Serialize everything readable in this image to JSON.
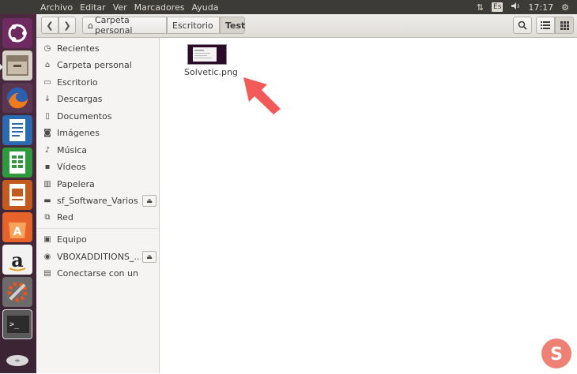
{
  "menubar": {
    "items": [
      "Archivo",
      "Editar",
      "Ver",
      "Marcadores",
      "Ayuda"
    ],
    "keyboard_layout": "Es",
    "clock": "17:17"
  },
  "launcher": {
    "apps": [
      "ubuntu-dash",
      "files",
      "firefox",
      "libreoffice-writer",
      "libreoffice-calc",
      "libreoffice-impress",
      "ubuntu-software",
      "amazon",
      "system-settings",
      "terminal",
      "dvd"
    ]
  },
  "toolbar": {
    "back_icon": "chevron-left-icon",
    "forward_icon": "chevron-right-icon",
    "breadcrumbs": [
      "Carpeta personal",
      "Escritorio",
      "Test"
    ],
    "home_glyph": "⌂",
    "search_icon": "search-icon",
    "list_view_icon": "list-icon",
    "grid_view_icon": "grid-icon"
  },
  "sidebar": {
    "items": [
      {
        "label": "Recientes",
        "icon": "clock-icon"
      },
      {
        "label": "Carpeta personal",
        "icon": "home-icon"
      },
      {
        "label": "Escritorio",
        "icon": "folder-icon"
      },
      {
        "label": "Descargas",
        "icon": "download-icon"
      },
      {
        "label": "Documentos",
        "icon": "document-icon"
      },
      {
        "label": "Imágenes",
        "icon": "camera-icon"
      },
      {
        "label": "Música",
        "icon": "music-icon"
      },
      {
        "label": "Vídeos",
        "icon": "video-icon"
      },
      {
        "label": "Papelera",
        "icon": "trash-icon"
      },
      {
        "label": "sf_Software_Varios",
        "icon": "drive-icon",
        "eject": true
      },
      {
        "label": "Red",
        "icon": "network-icon"
      }
    ],
    "devices": [
      {
        "label": "Equipo",
        "icon": "computer-icon"
      },
      {
        "label": "VBOXADDITIONS_...",
        "icon": "disc-icon",
        "eject": true
      },
      {
        "label": "Conectarse con un servi...",
        "icon": "connect-server-icon"
      }
    ]
  },
  "content": {
    "files": [
      {
        "name": "Solvetic.png",
        "icon": "image-thumbnail"
      }
    ]
  },
  "colors": {
    "panel": "#3c3b37",
    "launcher": "#4b2a3f",
    "annotation_arrow": "#f25a5a",
    "sidebar_bg": "#f5f4f2"
  }
}
